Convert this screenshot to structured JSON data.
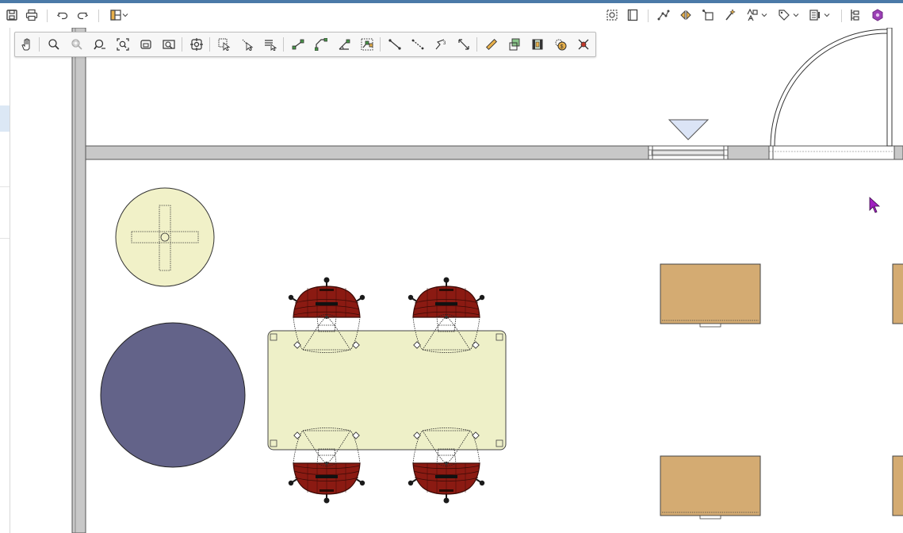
{
  "top_toolbar": {
    "left_icons": [
      "save-icon",
      "print-icon",
      "undo-icon",
      "redo-icon",
      "layout-icon",
      "chevron-down-icon"
    ],
    "right_icons": [
      "fit-view-icon",
      "book-icon",
      "points-icon",
      "mirror-icon",
      "transform-icon",
      "wand-icon",
      "text-style-icon",
      "chevron-down-icon",
      "tag-icon",
      "chevron-down-icon",
      "list-icon",
      "chevron-down-icon",
      "hierarchy-icon",
      "plugin-icon"
    ]
  },
  "floating_toolbar": {
    "icons": [
      "pan-hand-icon",
      "zoom-icon",
      "zoom-disabled-icon",
      "zoom-previous-icon",
      "zoom-extents-icon",
      "zoom-window-icon",
      "zoom-selection-icon",
      "center-view-icon",
      "select-icon",
      "deselect-icon",
      "select-list-icon",
      "point-snap-icon",
      "edge-snap-icon",
      "angle-snap-icon",
      "grid-snap-icon",
      "line-icon",
      "dashed-line-icon",
      "point-count-icon",
      "dimension-icon",
      "ruler-icon",
      "area-icon",
      "film-icon",
      "money-icon",
      "delete-icon"
    ]
  },
  "floorplan": {
    "colors": {
      "wall": "#c8c8c8",
      "round_table_light": "#f1f1c8",
      "round_table_dark": "#636389",
      "conference_table": "#eef0c8",
      "chair": "#8b1a12",
      "desk": "#d4ab72",
      "door_marker": "#dbe4f6",
      "cursor": "#a020c0"
    }
  }
}
